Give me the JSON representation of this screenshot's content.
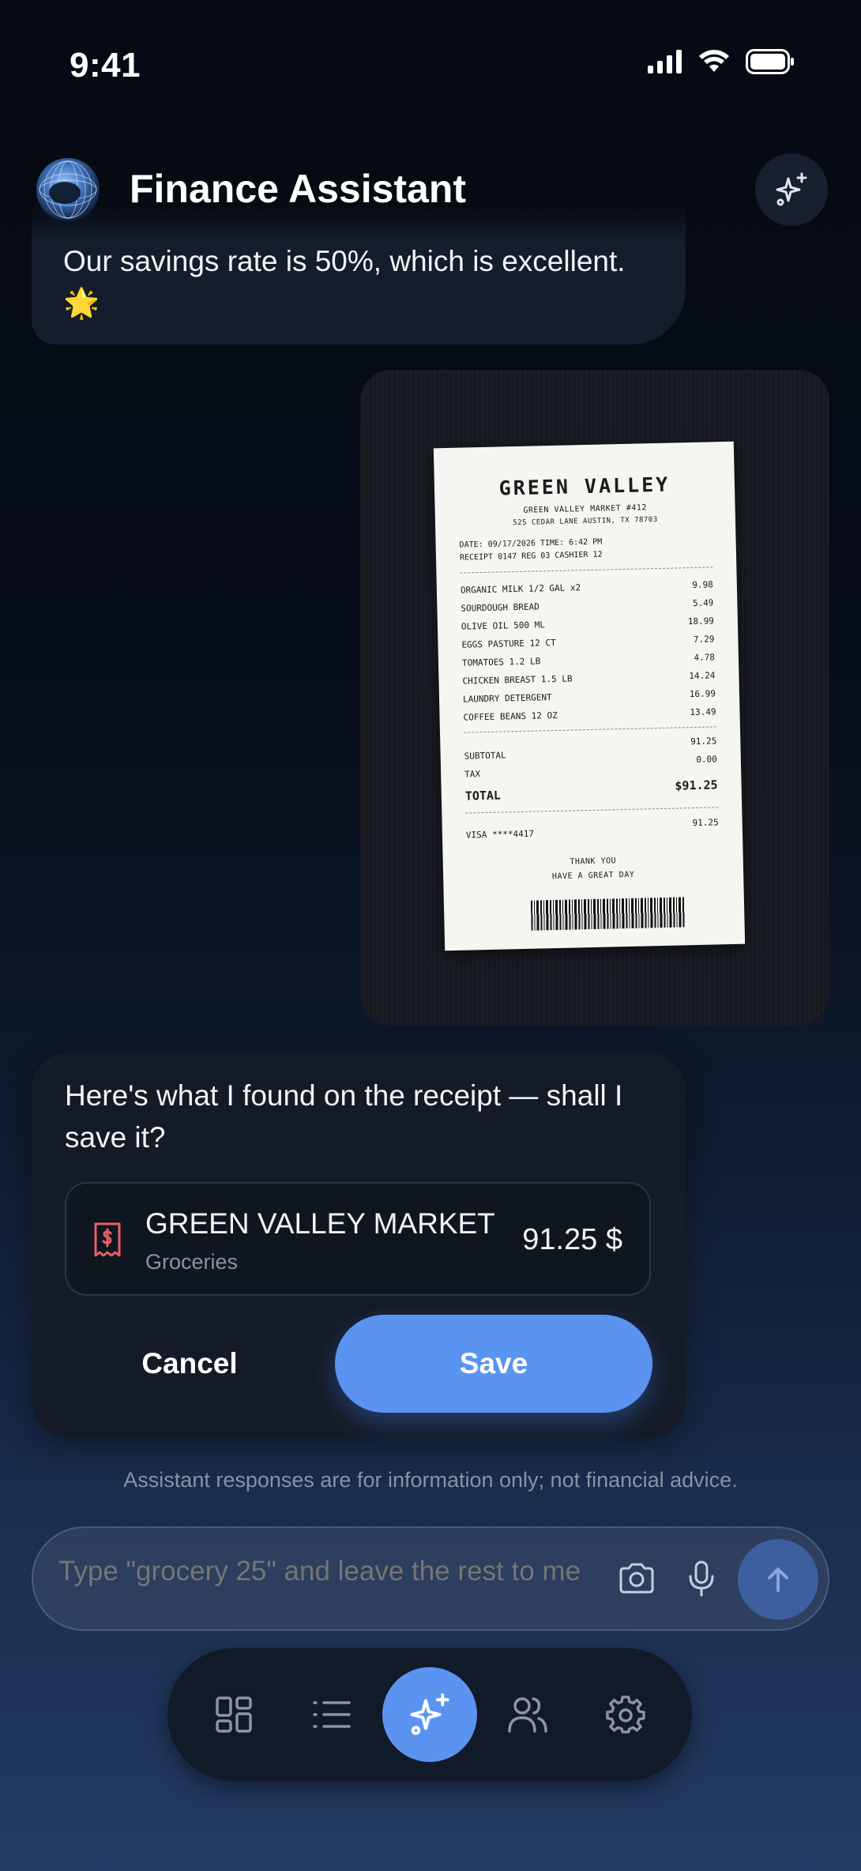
{
  "status_bar": {
    "time": "9:41"
  },
  "header": {
    "title": "Finance Assistant"
  },
  "messages": {
    "previous_text": "Our savings rate is 50%, which is excellent. 🌟",
    "confirm_text": "Here's what I found on the receipt — shall I save it?"
  },
  "receipt": {
    "store": "GREEN VALLEY",
    "store_line": "GREEN VALLEY MARKET #412",
    "address": "525 CEDAR LANE AUSTIN, TX 78703",
    "date_line": "DATE: 09/17/2026 TIME: 6:42 PM",
    "receipt_line": "RECEIPT 0147 REG 03 CASHIER 12",
    "items": [
      {
        "name": "ORGANIC MILK 1/2 GAL x2",
        "price": "9.98"
      },
      {
        "name": "SOURDOUGH BREAD",
        "price": "5.49"
      },
      {
        "name": "OLIVE OIL 500 ML",
        "price": "18.99"
      },
      {
        "name": "EGGS PASTURE 12 CT",
        "price": "7.29"
      },
      {
        "name": "TOMATOES 1.2 LB",
        "price": "4.78"
      },
      {
        "name": "CHICKEN BREAST 1.5 LB",
        "price": "14.24"
      },
      {
        "name": "LAUNDRY DETERGENT",
        "price": "16.99"
      },
      {
        "name": "COFFEE BEANS 12 OZ",
        "price": "13.49"
      }
    ],
    "subtotal_label": "SUBTOTAL",
    "subtotal": "91.25",
    "tax_label": "TAX",
    "tax": "0.00",
    "total_label": "TOTAL",
    "total": "$91.25",
    "payment_label": "VISA ****4417",
    "payment": "91.25",
    "thanks_1": "THANK YOU",
    "thanks_2": "HAVE A GREAT DAY"
  },
  "transaction": {
    "merchant": "GREEN VALLEY MARKET",
    "category": "Groceries",
    "amount": "91.25 $",
    "icon": "receipt-dollar-icon"
  },
  "actions": {
    "cancel_label": "Cancel",
    "save_label": "Save"
  },
  "disclaimer": "Assistant responses are for information only; not financial advice.",
  "composer": {
    "placeholder": "Type \"grocery 25\" and leave the rest to me"
  },
  "tabbar": {
    "tabs": [
      "dashboard-icon",
      "list-icon",
      "sparkle-icon",
      "people-icon",
      "gear-icon"
    ],
    "active": "sparkle-icon"
  },
  "colors": {
    "accent": "#5b93f1",
    "receipt_icon": "#e8606a"
  }
}
